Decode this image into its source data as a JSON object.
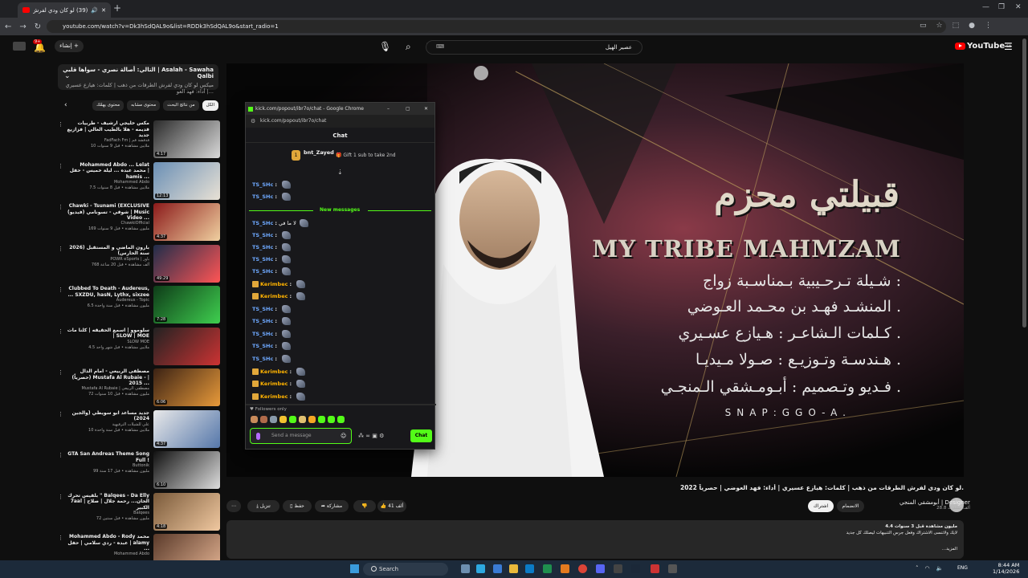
{
  "browser": {
    "tab_title": "(39) لو كان ودي لفرش الطرقـ",
    "address_url": "youtube.com/watch?v=Dk3hSdQAL9o&list=RDDk3hSdQAL9o&start_radio=1"
  },
  "youtube": {
    "create_label": "إنشاء",
    "notif_count": "9+",
    "search_value": "عصير الهيل",
    "logo_text": "YouTube",
    "logo_region": "SA"
  },
  "playlist": {
    "title": "التالي: أصالة نصري - سواها قلبي | Asalah - Sawaha Qalbi",
    "subtitle": "ميكس لو كان ودي لفرش الطرقات من ذهب | كلمات: هيازع عسيري | أداء: فهد العو..."
  },
  "chips": [
    "الكل",
    "من نتائج البحث",
    "محتوى مشابه",
    "محتوى يهمّك"
  ],
  "videos": [
    {
      "title": "مكس خليجي ارشيف - طربيات قديمه - هلا بالطيب الغالي | فزازيع جديد",
      "channel": "FadFach Fm | فدفشة فم",
      "meta": "10 ملايين مشاهدة • قبل 9 سنوات",
      "duration": "4:17"
    },
    {
      "title": "Mohammed Abdo ... Lelat محمد عبده ... ليلة خميس - حفل | hamis ...",
      "channel": "Mohammed Abdo",
      "meta": "7.5 ملايين مشاهدة • قبل 8 سنوات",
      "duration": "12:13"
    },
    {
      "title": "Chawki - Tsunami (EXCLUSIVE شوقي - تسونامي (فيديو) | Music Video ...",
      "channel": "ChawkiOfficial",
      "meta": "169 مليون مشاهدة • قبل 9 سنوات",
      "duration": "4:37"
    },
    {
      "title": "بارون الماضي و المستقبل (2026 سنة الحارس)",
      "channel": "POWR eSports | باور",
      "meta": "768 ألف مشاهدة • قبل 20 ساعة",
      "duration": "49:29"
    },
    {
      "title": "Clubbed To Death - Audereus, ... SXZDU, hasN, Lythx, sixzee",
      "channel": "Audereus - Topic",
      "meta": "6.5 مليون مشاهدة • قبل سنة واحدة",
      "duration": "7:28"
    },
    {
      "title": "سلوموو | اسمع الحقيقه | كلنا مات | SLOW | MOE",
      "channel": "SLOW MOE",
      "meta": "4.5 ملايين مشاهدة • قبل شهر واحد",
      "duration": ""
    },
    {
      "title": "مصطفى الربيعي - امام الدال (حصرياً) Mustafa Al Rubaie - | 2015 ...",
      "channel": "Mustafa Al Rubaie | مصطفى الربيعي",
      "meta": "72 مليون مشاهدة • قبل 10 سنوات",
      "duration": "6:06"
    },
    {
      "title": "جديد مساعد ابو سويطي (والجين 2024)",
      "channel": "علي للشيلات الترفيهية",
      "meta": "10 ملايين مشاهدة • قبل سنة واحدة",
      "duration": "4:37"
    },
    {
      "title": "GTA San Andreas Theme Song Full !",
      "channel": "Buttonik",
      "meta": "99 مليون مشاهدة • قبل 17 سنة",
      "duration": "6:10"
    },
    {
      "title": "بلقيس تحرك \" Balqees - Da Elly 7aal | الحان... رحمة جلال | صلاح الكبير",
      "channel": "Balqees",
      "meta": "72 مليون مشاهدة • قبل سنتين",
      "duration": "4:18"
    },
    {
      "title": "Mohammed Abdo - Rody محمد عبده - ردي سلامي | حفل | alamy ...",
      "channel": "Mohammed Abdo",
      "meta": "",
      "duration": ""
    }
  ],
  "player": {
    "title_ar": "قبيلتي محزم",
    "title_en": "MY TRIBE MAHMZAM",
    "line1": "شـيلة تـرحـيبية بـمناسـبة زواج :",
    "line2": "المنشـد فهـد بن محـمد العـوضي .",
    "line3": "كـلمات الـشاعـر : هـيازع عسـيري .",
    "line4": "هـندسـة وتـوزيـع : صـولا مـيديـا .",
    "line5": "فـديو وتـصميم : أبـومـشقي الـمنجـي .",
    "snap": "SNAP:GGO-A."
  },
  "chat": {
    "window_title": "kick.com/popout/ibr7o/chat - Google Chrome",
    "url": "kick.com/popout/ibr7o/chat",
    "header": "Chat",
    "pinned_user": "bnt_Zayed",
    "pinned_count": "1",
    "gift_text": "Gift 1 sub to take 2nd",
    "new_messages": "New messages",
    "followers_only": "Followers only",
    "input_placeholder": "Send a message",
    "send_label": "Chat",
    "messages": [
      {
        "user": "TS_SHc",
        "text": ""
      },
      {
        "user": "TS_SHc",
        "text": ""
      },
      {
        "user": "TS_SHc",
        "text": "لا ما في"
      },
      {
        "user": "TS_SHc",
        "text": ""
      },
      {
        "user": "TS_SHc",
        "text": ""
      },
      {
        "user": "TS_SHc",
        "text": ""
      },
      {
        "user": "TS_SHc",
        "text": ""
      },
      {
        "user": "Kerimbec",
        "text": ""
      },
      {
        "user": "Kerimbec",
        "text": ""
      },
      {
        "user": "TS_SHc",
        "text": ""
      },
      {
        "user": "TS_SHc",
        "text": ""
      },
      {
        "user": "TS_SHc",
        "text": ""
      },
      {
        "user": "TS_SHc",
        "text": ""
      },
      {
        "user": "TS_SHc",
        "text": ""
      },
      {
        "user": "Kerimbec",
        "text": ""
      },
      {
        "user": "Kerimbec",
        "text": ""
      },
      {
        "user": "Kerimbec",
        "text": ""
      }
    ]
  },
  "watch": {
    "title": "لو كان ودي لفرش الطرقات من ذهب | كلمات: هيازع عسيري | أداء: فهد العوضي | حصرياً 2022.",
    "channel": "أبومشقي المنجي | Designer",
    "subscribers": "28.8 ألف مشترك",
    "joined_label": "الانضمام",
    "subscribe_label": "اشتراك",
    "likes": "41 ألف",
    "share_label": "مشاركة",
    "save_label": "حفظ",
    "download_label": "تنزيل",
    "desc_stats": "4.4 مليون مشاهدة  قبل 3 سنوات",
    "desc_line": "لايك ولاتنسى الاشتراك وفعل جرس التنبيهات ليصلك كل جديد",
    "desc_more": "...المزيد"
  },
  "taskbar": {
    "search_label": "Search",
    "lang": "ENG",
    "time": "8:44 AM",
    "date": "1/14/2026"
  }
}
